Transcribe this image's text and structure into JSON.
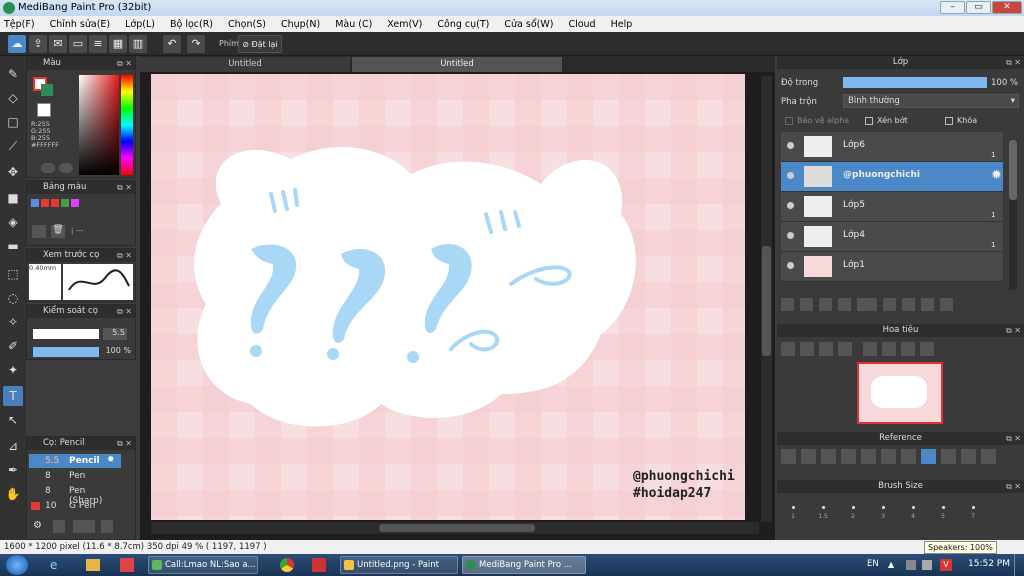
{
  "window": {
    "title": "MediBang Paint Pro (32bit)"
  },
  "menu": [
    "Tệp(F)",
    "Chỉnh sửa(E)",
    "Lớp(L)",
    "Bộ lọc(R)",
    "Chọn(S)",
    "Chụp(N)",
    "Màu (C)",
    "Xem(V)",
    "Công cụ(T)",
    "Cửa sổ(W)",
    "Cloud",
    "Help"
  ],
  "toolbar": {
    "shortcut_label": "Phím",
    "reset_label": "Đặt lại"
  },
  "color_panel": {
    "title": "Màu",
    "r": "R:255",
    "g": "G:255",
    "b": "B:255",
    "hex": "#FFFFFF"
  },
  "palette_panel": {
    "title": "Bảng màu",
    "dots": "| ---"
  },
  "brush_preview": {
    "title": "Xem trước cọ",
    "size": "0.40mm"
  },
  "brush_control": {
    "title": "Kiểm soát cọ",
    "size_value": "5.5",
    "opacity_value": "100 %"
  },
  "brush_list": {
    "title": "Cọ: Pencil",
    "items": [
      {
        "size": "5.5",
        "name": "Pencil"
      },
      {
        "size": "8",
        "name": "Pen"
      },
      {
        "size": "8",
        "name": "Pen (Sharp)"
      },
      {
        "size": "10",
        "name": "G Pen"
      }
    ]
  },
  "tabs": [
    "Untitled",
    "Untitled"
  ],
  "artwork": {
    "watermark_line1": "@phuongchichi",
    "watermark_line2": "#hoidap247",
    "symbols": [
      "?",
      "?",
      "?"
    ]
  },
  "layer_panel": {
    "title": "Lớp",
    "opacity_label": "Độ trong",
    "opacity_value": "100 %",
    "blend_label": "Pha trộn",
    "blend_value": "Bình thường",
    "protect_alpha": "Bảo vệ alpha",
    "clipping": "Xén bớt",
    "lock": "Khóa",
    "layers": [
      {
        "name": "Lớp6",
        "badge": "1"
      },
      {
        "name": "@phuongchichi",
        "badge": ""
      },
      {
        "name": "Lớp5",
        "badge": "1"
      },
      {
        "name": "Lớp4",
        "badge": "1"
      },
      {
        "name": "Lớp1",
        "badge": ""
      }
    ]
  },
  "navigator": {
    "title": "Hoa tiêu"
  },
  "reference": {
    "title": "Reference"
  },
  "brush_size": {
    "title": "Brush Size",
    "sizes": [
      "1",
      "1.5",
      "2",
      "3",
      "4",
      "5",
      "7"
    ]
  },
  "status": {
    "text": "1600 * 1200 pixel  (11.6 * 8.7cm)  350 dpi  49 %  ( 1197, 1197 )"
  },
  "taskbar": {
    "items": [
      "Call:Lmao NL:Sao a...",
      "Untitled.png - Paint",
      "MediBang Paint Pro ..."
    ],
    "lang": "EN",
    "time": "15:52 PM",
    "tooltip": "Speakers: 100%"
  },
  "colors": {
    "accent": "#4a88c7",
    "canvas_pink": "#f7d9dc",
    "question_blue": "#a8d8f5"
  }
}
